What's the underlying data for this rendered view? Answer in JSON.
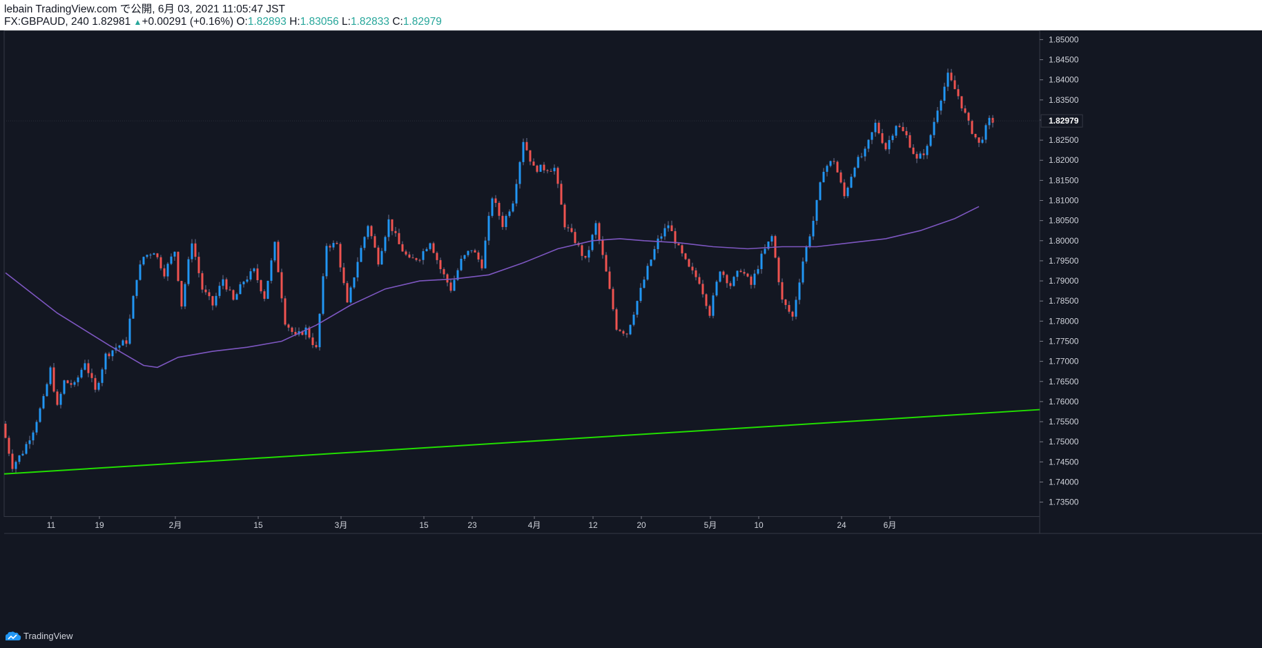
{
  "header": {
    "line1": "lebain TradingView.com で公開, 6月 03, 2021 11:05:47 JST",
    "symbol_info": "FX:GBPAUD, 240 1.82981",
    "change": "+0.00291 (+0.16%)",
    "open_label": "O:",
    "open": "1.82893",
    "high_label": "H:",
    "high": "1.83056",
    "low_label": "L:",
    "low": "1.82833",
    "close_label": "C:",
    "close": "1.82979"
  },
  "footer": {
    "brand": "TradingView"
  },
  "colors": {
    "background": "#131722",
    "up_candle": "#2196f3",
    "down_candle": "#ef5350",
    "moving_average": "#7e57c2",
    "trendline": "#22e000",
    "axis_text": "#d1d4dc",
    "price_label_bg": "#131722"
  },
  "chart_data": {
    "type": "candlestick",
    "symbol": "FX:GBPAUD",
    "interval": "240",
    "y_axis": {
      "ticks": [
        1.735,
        1.74,
        1.745,
        1.75,
        1.755,
        1.76,
        1.765,
        1.77,
        1.775,
        1.78,
        1.785,
        1.79,
        1.795,
        1.8,
        1.805,
        1.81,
        1.815,
        1.82,
        1.825,
        1.83,
        1.835,
        1.84,
        1.845,
        1.85
      ],
      "tick_labels": [
        "1.73500",
        "1.74000",
        "1.74500",
        "1.75000",
        "1.75500",
        "1.76000",
        "1.76500",
        "1.77000",
        "1.77500",
        "1.78000",
        "1.78500",
        "1.79000",
        "1.79500",
        "1.80000",
        "1.80500",
        "1.81000",
        "1.81500",
        "1.82000",
        "1.82500",
        "1.83000",
        "1.83500",
        "1.84000",
        "1.84500",
        "1.85000"
      ],
      "range": [
        1.7315,
        1.8523
      ],
      "last_price_label": "1.82979",
      "last_price": 1.82979
    },
    "x_axis": {
      "tick_labels": [
        "11",
        "19",
        "2月",
        "15",
        "3月",
        "15",
        "23",
        "4月",
        "12",
        "20",
        "5月",
        "10",
        "24",
        "6月"
      ],
      "tick_bar_index": [
        6,
        20,
        42,
        66,
        90,
        114,
        128,
        146,
        163,
        177,
        197,
        211,
        235,
        249
      ]
    },
    "path_anchors": [
      [
        0,
        1.7545
      ],
      [
        3,
        1.744
      ],
      [
        6,
        1.7475
      ],
      [
        9,
        1.753
      ],
      [
        12,
        1.7605
      ],
      [
        14,
        1.768
      ],
      [
        16,
        1.7585
      ],
      [
        18,
        1.765
      ],
      [
        21,
        1.764
      ],
      [
        24,
        1.77
      ],
      [
        27,
        1.7625
      ],
      [
        30,
        1.7715
      ],
      [
        33,
        1.7735
      ],
      [
        36,
        1.775
      ],
      [
        39,
        1.791
      ],
      [
        41,
        1.796
      ],
      [
        44,
        1.7975
      ],
      [
        47,
        1.792
      ],
      [
        50,
        1.7975
      ],
      [
        52,
        1.784
      ],
      [
        55,
        1.8
      ],
      [
        58,
        1.788
      ],
      [
        61,
        1.784
      ],
      [
        64,
        1.7905
      ],
      [
        67,
        1.785
      ],
      [
        70,
        1.79
      ],
      [
        73,
        1.7925
      ],
      [
        76,
        1.786
      ],
      [
        79,
        1.799
      ],
      [
        82,
        1.78
      ],
      [
        85,
        1.776
      ],
      [
        88,
        1.778
      ],
      [
        91,
        1.773
      ],
      [
        94,
        1.799
      ],
      [
        97,
        1.799
      ],
      [
        100,
        1.784
      ],
      [
        103,
        1.795
      ],
      [
        106,
        1.804
      ],
      [
        109,
        1.795
      ],
      [
        112,
        1.805
      ],
      [
        115,
        1.799
      ],
      [
        118,
        1.795
      ],
      [
        121,
        1.796
      ],
      [
        124,
        1.8
      ],
      [
        127,
        1.793
      ],
      [
        130,
        1.788
      ],
      [
        133,
        1.795
      ],
      [
        136,
        1.798
      ],
      [
        139,
        1.794
      ],
      [
        142,
        1.811
      ],
      [
        145,
        1.804
      ],
      [
        148,
        1.81
      ],
      [
        151,
        1.825
      ],
      [
        154,
        1.818
      ],
      [
        157,
        1.818
      ],
      [
        160,
        1.818
      ],
      [
        163,
        1.804
      ],
      [
        166,
        1.8
      ],
      [
        169,
        1.795
      ],
      [
        172,
        1.804
      ],
      [
        175,
        1.792
      ],
      [
        178,
        1.7785
      ],
      [
        181,
        1.777
      ],
      [
        184,
        1.785
      ],
      [
        187,
        1.793
      ],
      [
        190,
        1.8
      ],
      [
        193,
        1.804
      ],
      [
        196,
        1.798
      ],
      [
        199,
        1.793
      ],
      [
        202,
        1.79
      ],
      [
        205,
        1.782
      ],
      [
        208,
        1.793
      ],
      [
        211,
        1.789
      ],
      [
        214,
        1.793
      ],
      [
        217,
        1.789
      ],
      [
        220,
        1.796
      ],
      [
        223,
        1.801
      ],
      [
        226,
        1.785
      ],
      [
        229,
        1.781
      ],
      [
        232,
        1.795
      ],
      [
        235,
        1.805
      ],
      [
        238,
        1.818
      ],
      [
        241,
        1.82
      ],
      [
        244,
        1.811
      ],
      [
        247,
        1.819
      ],
      [
        250,
        1.822
      ],
      [
        253,
        1.829
      ],
      [
        256,
        1.823
      ],
      [
        259,
        1.829
      ],
      [
        262,
        1.826
      ],
      [
        265,
        1.82
      ],
      [
        268,
        1.823
      ],
      [
        271,
        1.833
      ],
      [
        274,
        1.841
      ],
      [
        277,
        1.836
      ],
      [
        280,
        1.829
      ],
      [
        283,
        1.824
      ],
      [
        286,
        1.8298
      ]
    ],
    "moving_average": [
      [
        0,
        1.792
      ],
      [
        15,
        1.782
      ],
      [
        30,
        1.774
      ],
      [
        40,
        1.769
      ],
      [
        44,
        1.7685
      ],
      [
        50,
        1.771
      ],
      [
        60,
        1.7725
      ],
      [
        70,
        1.7735
      ],
      [
        80,
        1.775
      ],
      [
        90,
        1.779
      ],
      [
        100,
        1.784
      ],
      [
        110,
        1.788
      ],
      [
        120,
        1.79
      ],
      [
        130,
        1.7905
      ],
      [
        140,
        1.7915
      ],
      [
        150,
        1.7945
      ],
      [
        160,
        1.798
      ],
      [
        170,
        1.8
      ],
      [
        178,
        1.8005
      ],
      [
        185,
        1.8
      ],
      [
        195,
        1.7995
      ],
      [
        205,
        1.7985
      ],
      [
        215,
        1.798
      ],
      [
        225,
        1.7985
      ],
      [
        235,
        1.7985
      ],
      [
        245,
        1.7995
      ],
      [
        255,
        1.8005
      ],
      [
        265,
        1.8025
      ],
      [
        275,
        1.8055
      ],
      [
        282,
        1.8085
      ]
    ],
    "trendline": {
      "start": [
        0,
        1.742
      ],
      "end": [
        290,
        1.758
      ]
    },
    "total_bars": 290
  }
}
